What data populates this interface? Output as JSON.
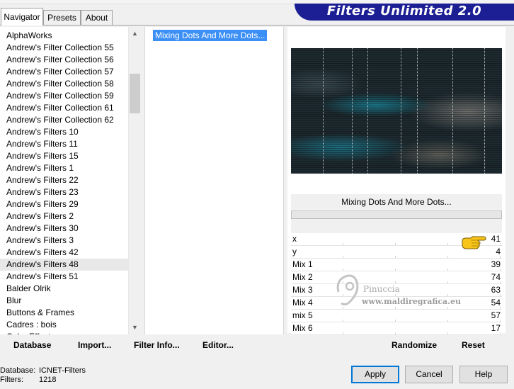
{
  "window": {
    "banner_title": "Filters Unlimited 2.0"
  },
  "tabs": [
    {
      "label": "Navigator",
      "active": true
    },
    {
      "label": "Presets",
      "active": false
    },
    {
      "label": "About",
      "active": false
    }
  ],
  "categories": [
    "AlphaWorks",
    "Andrew's Filter Collection 55",
    "Andrew's Filter Collection 56",
    "Andrew's Filter Collection 57",
    "Andrew's Filter Collection 58",
    "Andrew's Filter Collection 59",
    "Andrew's Filter Collection 61",
    "Andrew's Filter Collection 62",
    "Andrew's Filters 10",
    "Andrew's Filters 11",
    "Andrew's Filters 15",
    "Andrew's Filters 1",
    "Andrew's Filters 22",
    "Andrew's Filters 23",
    "Andrew's Filters 29",
    "Andrew's Filters 2",
    "Andrew's Filters 30",
    "Andrew's Filters 3",
    "Andrew's Filters 42",
    "Andrew's Filters 48",
    "Andrew's Filters 51",
    "Balder Olrik",
    "Blur",
    "Buttons & Frames",
    "Cadres : bois",
    "Color Effects"
  ],
  "selected_category": "Andrew's Filters 48",
  "filters": [
    "Mixing Dots And More Dots..."
  ],
  "filter_name": "Mixing Dots And More Dots...",
  "sliders": [
    {
      "label": "x",
      "value": 41
    },
    {
      "label": "y",
      "value": 4
    },
    {
      "label": "Mix 1",
      "value": 39
    },
    {
      "label": "Mix 2",
      "value": 74
    },
    {
      "label": "Mix 3",
      "value": 63
    },
    {
      "label": "Mix 4",
      "value": 54
    },
    {
      "label": "mix 5",
      "value": 57
    },
    {
      "label": "Mix 6",
      "value": 17
    }
  ],
  "left_buttons": {
    "database": "Database",
    "import": "Import...",
    "filter_info": "Filter Info...",
    "editor": "Editor..."
  },
  "right_buttons": {
    "randomize": "Randomize",
    "reset": "Reset"
  },
  "watermark": {
    "line1": "Pinuccia",
    "line2": "www.maldiregrafica.eu"
  },
  "status": {
    "database_label": "Database:",
    "database_value": "ICNET-Filters",
    "filters_label": "Filters:",
    "filters_value": "1218"
  },
  "dialog_buttons": {
    "apply": "Apply",
    "cancel": "Cancel",
    "help": "Help"
  },
  "colors": {
    "banner": "#1c1f94",
    "selection": "#3c8ff5",
    "default_button_border": "#0078d7"
  },
  "icons": {
    "scroll_up": "scroll-up-icon",
    "scroll_down": "scroll-down-icon",
    "pointer": "pointing-hand-icon"
  }
}
